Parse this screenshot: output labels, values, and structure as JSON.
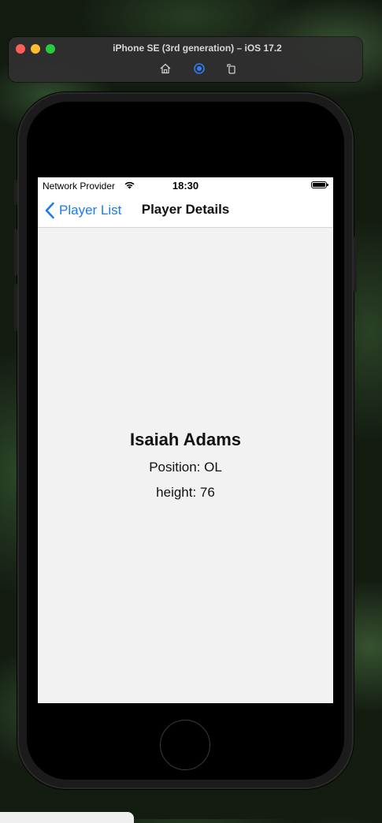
{
  "simulator": {
    "title": "iPhone SE (3rd generation) – iOS 17.2",
    "icons": [
      "home-icon",
      "screenshot-icon",
      "rotate-icon"
    ]
  },
  "status_bar": {
    "carrier": "Network Provider",
    "time": "18:30"
  },
  "nav": {
    "back_label": "Player List",
    "title": "Player Details"
  },
  "player": {
    "name": "Isaiah Adams",
    "position": "Position: OL",
    "height": "height: 76"
  },
  "colors": {
    "accent": "#1a7bf2",
    "screen_bg": "#f2f2f2"
  }
}
